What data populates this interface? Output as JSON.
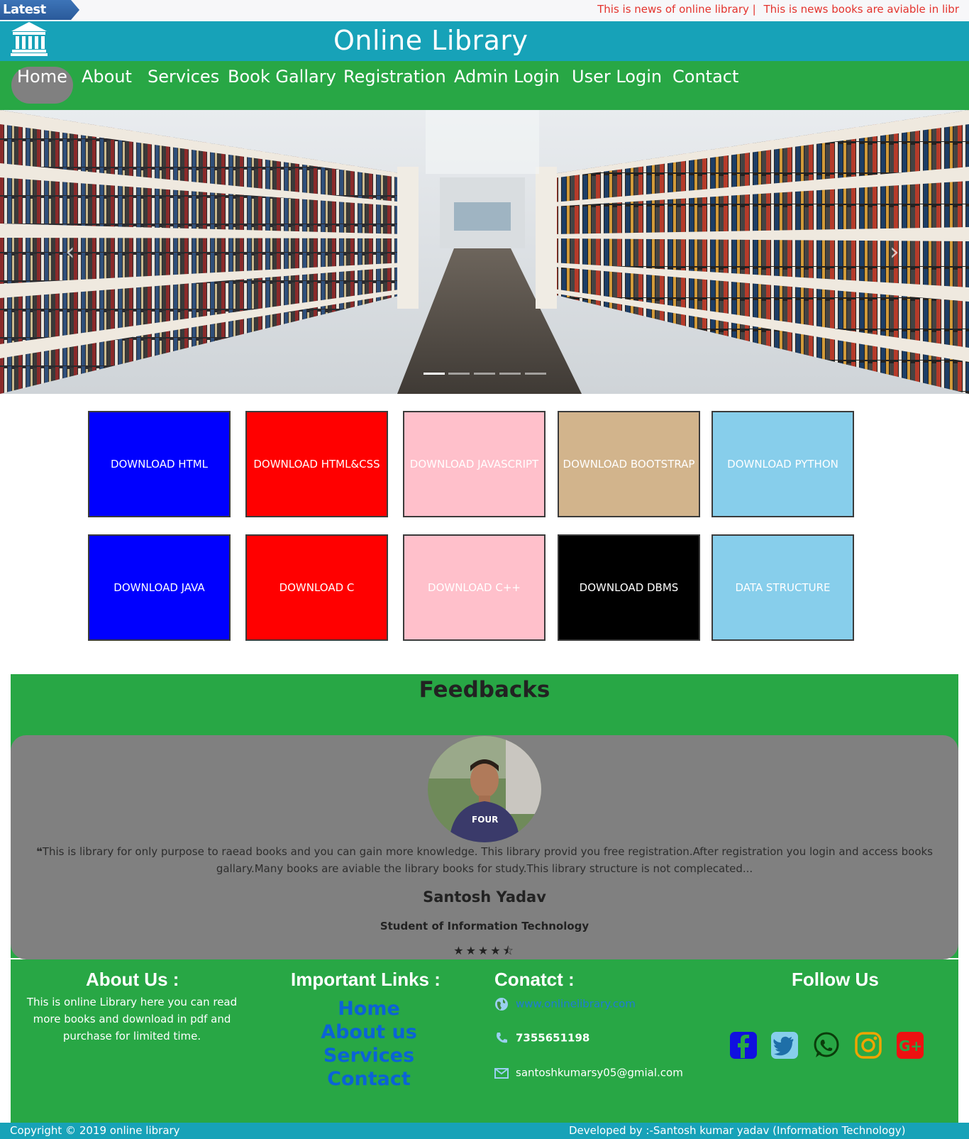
{
  "ticker": {
    "badge": "Latest News",
    "items": [
      "This is news of online library |",
      "This is news books are aviable in libr"
    ]
  },
  "header": {
    "title": "Online Library",
    "logo_icon": "library-building-icon"
  },
  "nav": {
    "items": [
      "Home",
      "About",
      "Services",
      "Book Gallary",
      "Registration",
      "Admin Login",
      "User Login",
      "Contact"
    ],
    "active": "Home"
  },
  "carousel": {
    "prev_icon": "chevron-left-icon",
    "next_icon": "chevron-right-icon",
    "slides": 5,
    "active_slide": 1
  },
  "downloads": [
    {
      "label": "DOWNLOAD HTML",
      "bg": "#0000ff"
    },
    {
      "label": "DOWNLOAD HTML&CSS",
      "bg": "#ff0000"
    },
    {
      "label": "DOWNLOAD JAVASCRIPT",
      "bg": "#ffc0cb"
    },
    {
      "label": "DOWNLOAD BOOTSTRAP",
      "bg": "#d2b48c"
    },
    {
      "label": "DOWNLOAD PYTHON",
      "bg": "#87ceeb"
    },
    {
      "label": "DOWNLOAD JAVA",
      "bg": "#0000ff"
    },
    {
      "label": "DOWNLOAD C",
      "bg": "#ff0000"
    },
    {
      "label": "DOWNLOAD C++",
      "bg": "#ffc0cb"
    },
    {
      "label": "DOWNLOAD DBMS",
      "bg": "#000000"
    },
    {
      "label": "DATA STRUCTURE",
      "bg": "#87ceeb"
    }
  ],
  "feedback": {
    "title": "Feedbacks",
    "quote": "This is library for only purpose to raead books and you can gain more knowledge. This library provid you free registration.After registration you login and access books gallary.Many books are aviable the library books for study.This library structure is not complecated...",
    "name": "Santosh Yadav",
    "role": "Student of Information Technology",
    "rating": 4.5
  },
  "footer": {
    "about_title": "About Us :",
    "about_text": "This is online Library here you can read more books and download in pdf and purchase for limited time.",
    "links_title": "Important Links :",
    "links": [
      "Home",
      "About us",
      "Services",
      "Contact"
    ],
    "contact_title": "Conatct :",
    "website": "www.onlinelibrary.com",
    "phone": "7355651198",
    "email": "santoshkumarsy05@gmial.com",
    "follow_title": "Follow Us",
    "social": [
      "facebook-icon",
      "twitter-icon",
      "whatsapp-icon",
      "instagram-icon",
      "google-plus-icon"
    ]
  },
  "bottom": {
    "copyright": "Copyright © 2019 online library",
    "developer": "Developed by :-Santosh kumar yadav (Information Technology)"
  },
  "colors": {
    "header_bg": "#17a2b8",
    "nav_bg": "#28a745",
    "active_nav_bg": "#808080",
    "ticker_text": "#e4332d",
    "link_blue": "#0b63d6"
  }
}
